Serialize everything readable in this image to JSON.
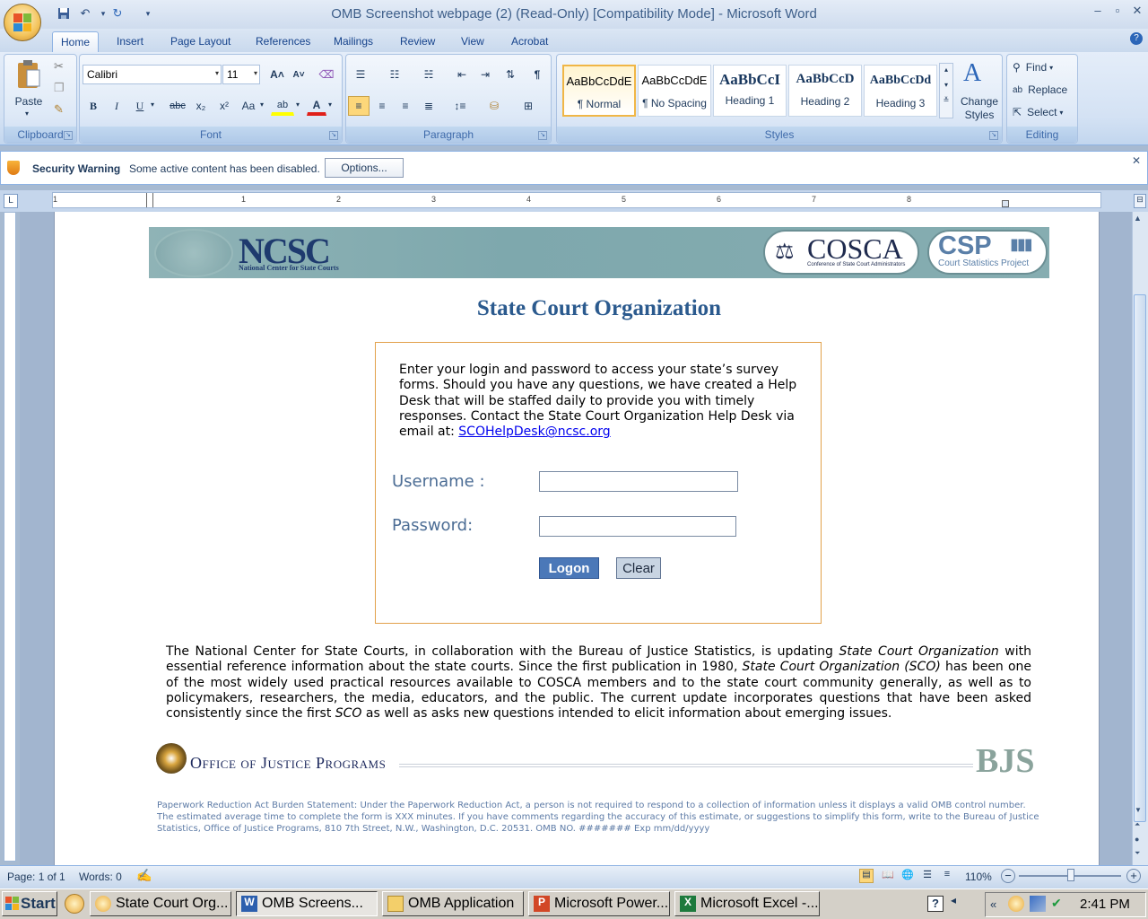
{
  "window": {
    "title": "OMB Screenshot webpage  (2) (Read-Only) [Compatibility Mode] - Microsoft Word",
    "minimize": "–",
    "maximize": "▫",
    "close": "✕"
  },
  "ribbon": {
    "tabs": [
      "Home",
      "Insert",
      "Page Layout",
      "References",
      "Mailings",
      "Review",
      "View",
      "Acrobat"
    ],
    "active_tab": "Home",
    "clipboard": {
      "label": "Clipboard",
      "paste": "Paste"
    },
    "font": {
      "label": "Font",
      "family": "Calibri",
      "size": "11",
      "bold": "B",
      "italic": "I",
      "underline": "U",
      "strike": "abc",
      "sub": "x₂",
      "sup": "x²",
      "change_case": "Aa",
      "grow": "A˄",
      "shrink": "A˅"
    },
    "paragraph": {
      "label": "Paragraph",
      "pilcrow": "¶"
    },
    "styles": {
      "label": "Styles",
      "items": [
        {
          "preview": "AaBbCcDdE",
          "name": "¶ Normal"
        },
        {
          "preview": "AaBbCcDdE",
          "name": "¶ No Spacing"
        },
        {
          "preview": "AaBbCcI",
          "name": "Heading 1"
        },
        {
          "preview": "AaBbCcD",
          "name": "Heading 2"
        },
        {
          "preview": "AaBbCcDd",
          "name": "Heading 3"
        }
      ],
      "change_styles": "Change Styles"
    },
    "editing": {
      "label": "Editing",
      "find": "Find",
      "replace": "Replace",
      "select": "Select"
    }
  },
  "security": {
    "title": "Security Warning",
    "message": "Some active content has been disabled.",
    "options": "Options..."
  },
  "ruler": {
    "marks": [
      "1",
      "1",
      "2",
      "3",
      "4",
      "5",
      "6",
      "7",
      "8"
    ]
  },
  "page": {
    "logos": {
      "ncsc": "NCSC",
      "ncsc_sub": "National Center for State Courts",
      "cosca": "COSCA",
      "cosca_sub": "Conference of State Court Administrators",
      "csp": "CSP",
      "csp_sub": "Court Statistics Project"
    },
    "title": "State Court Organization",
    "intro": "Enter your login and password to access your state’s survey forms. Should you have any questions, we have created a Help Desk that will be staffed daily to provide you with timely responses. Contact the State Court Organization Help Desk via email at: ",
    "help_email": "SCOHelpDesk@ncsc.org",
    "username_label": "Username :",
    "password_label": "Password:",
    "username_value": "",
    "password_value": "",
    "logon": "Logon",
    "clear": "Clear",
    "body": {
      "p1": "The National Center for State Courts, in collaboration with the Bureau of Justice Statistics, is updating ",
      "i1": "State Court Organization",
      "p2": " with essential reference information about the state courts. Since the first publication in 1980, ",
      "i2": "State Court Organization (SCO)",
      "p3": " has been one of the most widely used practical resources available to COSCA members and to the state court community generally, as well as to policymakers, researchers, the media, educators, and the public. The current update incorporates questions that have been asked consistently since the first ",
      "i3": "SCO",
      "p4": " as well as asks new questions intended to elicit information about emerging issues."
    },
    "ojp": "Office of Justice Programs",
    "bjs": "BJS",
    "paperwork": "Paperwork Reduction Act Burden Statement: Under the Paperwork Reduction Act, a person is not required to respond to a collection of information unless it displays a valid OMB control number. The estimated average time to complete the form is XXX minutes. If you have comments regarding the accuracy of this estimate, or suggestions to simplify this form, write to the Bureau of Justice Statistics, Office of Justice Programs, 810 7th Street, N.W., Washington, D.C. 20531. OMB NO. ####### Exp mm/dd/yyyy"
  },
  "status": {
    "page": "Page: 1 of 1",
    "words": "Words: 0",
    "zoom": "110%"
  },
  "taskbar": {
    "start": "Start",
    "tasks": [
      "State Court Org...",
      "OMB Screens...",
      "OMB Application",
      "Microsoft Power...",
      "Microsoft Excel -..."
    ],
    "active_task": 1,
    "clock": "2:41 PM"
  }
}
